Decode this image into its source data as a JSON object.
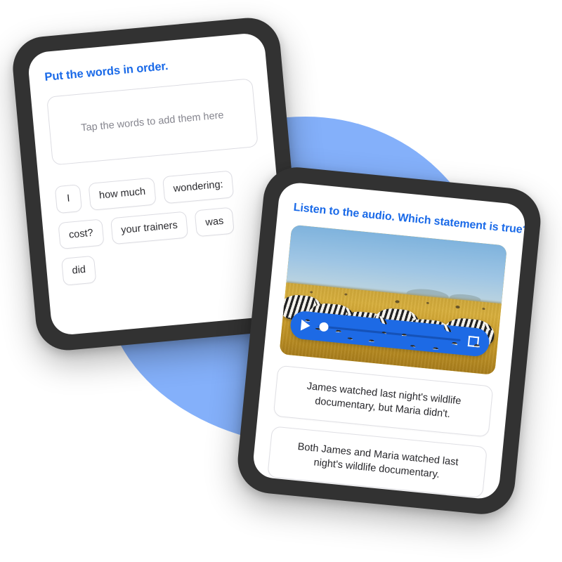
{
  "theme": {
    "accent_blue": "#1a6ae8",
    "player_blue": "#1d6ae5",
    "blob_blue": "#84b0fa",
    "frame_dark": "#323232",
    "card_border": "#dcdce2",
    "placeholder_gray": "#86868f"
  },
  "word_order_screen": {
    "title": "Put the words in order.",
    "dropzone_placeholder": "Tap the words to add them here",
    "word_chips": [
      {
        "label": "I"
      },
      {
        "label": "how much"
      },
      {
        "label": "wondering:"
      },
      {
        "label": "cost?"
      },
      {
        "label": "your trainers"
      },
      {
        "label": "was"
      },
      {
        "label": "did"
      }
    ]
  },
  "audio_question_screen": {
    "title": "Listen to the audio. Which statement is true?",
    "media": {
      "alt": "Herd of zebras grazing on golden savanna grassland under a blue sky",
      "sky_color": "#9ec5e4",
      "grass_color": "#c9a227"
    },
    "player": {
      "play_icon": "play-icon",
      "fullscreen_icon": "fullscreen-icon",
      "progress_percent": 2
    },
    "options": [
      {
        "label": "James watched last night's wildlife documentary, but Maria didn't."
      },
      {
        "label": "Both James and Maria watched last night's wildlife documentary."
      }
    ]
  }
}
